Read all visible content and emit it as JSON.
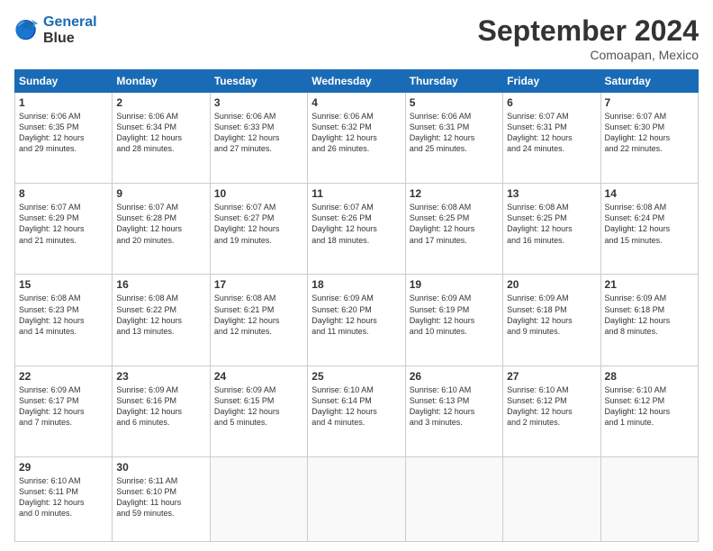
{
  "logo": {
    "line1": "General",
    "line2": "Blue"
  },
  "title": "September 2024",
  "location": "Comoapan, Mexico",
  "weekdays": [
    "Sunday",
    "Monday",
    "Tuesday",
    "Wednesday",
    "Thursday",
    "Friday",
    "Saturday"
  ],
  "weeks": [
    [
      {
        "day": "1",
        "lines": [
          "Sunrise: 6:06 AM",
          "Sunset: 6:35 PM",
          "Daylight: 12 hours",
          "and 29 minutes."
        ]
      },
      {
        "day": "2",
        "lines": [
          "Sunrise: 6:06 AM",
          "Sunset: 6:34 PM",
          "Daylight: 12 hours",
          "and 28 minutes."
        ]
      },
      {
        "day": "3",
        "lines": [
          "Sunrise: 6:06 AM",
          "Sunset: 6:33 PM",
          "Daylight: 12 hours",
          "and 27 minutes."
        ]
      },
      {
        "day": "4",
        "lines": [
          "Sunrise: 6:06 AM",
          "Sunset: 6:32 PM",
          "Daylight: 12 hours",
          "and 26 minutes."
        ]
      },
      {
        "day": "5",
        "lines": [
          "Sunrise: 6:06 AM",
          "Sunset: 6:31 PM",
          "Daylight: 12 hours",
          "and 25 minutes."
        ]
      },
      {
        "day": "6",
        "lines": [
          "Sunrise: 6:07 AM",
          "Sunset: 6:31 PM",
          "Daylight: 12 hours",
          "and 24 minutes."
        ]
      },
      {
        "day": "7",
        "lines": [
          "Sunrise: 6:07 AM",
          "Sunset: 6:30 PM",
          "Daylight: 12 hours",
          "and 22 minutes."
        ]
      }
    ],
    [
      {
        "day": "8",
        "lines": [
          "Sunrise: 6:07 AM",
          "Sunset: 6:29 PM",
          "Daylight: 12 hours",
          "and 21 minutes."
        ]
      },
      {
        "day": "9",
        "lines": [
          "Sunrise: 6:07 AM",
          "Sunset: 6:28 PM",
          "Daylight: 12 hours",
          "and 20 minutes."
        ]
      },
      {
        "day": "10",
        "lines": [
          "Sunrise: 6:07 AM",
          "Sunset: 6:27 PM",
          "Daylight: 12 hours",
          "and 19 minutes."
        ]
      },
      {
        "day": "11",
        "lines": [
          "Sunrise: 6:07 AM",
          "Sunset: 6:26 PM",
          "Daylight: 12 hours",
          "and 18 minutes."
        ]
      },
      {
        "day": "12",
        "lines": [
          "Sunrise: 6:08 AM",
          "Sunset: 6:25 PM",
          "Daylight: 12 hours",
          "and 17 minutes."
        ]
      },
      {
        "day": "13",
        "lines": [
          "Sunrise: 6:08 AM",
          "Sunset: 6:25 PM",
          "Daylight: 12 hours",
          "and 16 minutes."
        ]
      },
      {
        "day": "14",
        "lines": [
          "Sunrise: 6:08 AM",
          "Sunset: 6:24 PM",
          "Daylight: 12 hours",
          "and 15 minutes."
        ]
      }
    ],
    [
      {
        "day": "15",
        "lines": [
          "Sunrise: 6:08 AM",
          "Sunset: 6:23 PM",
          "Daylight: 12 hours",
          "and 14 minutes."
        ]
      },
      {
        "day": "16",
        "lines": [
          "Sunrise: 6:08 AM",
          "Sunset: 6:22 PM",
          "Daylight: 12 hours",
          "and 13 minutes."
        ]
      },
      {
        "day": "17",
        "lines": [
          "Sunrise: 6:08 AM",
          "Sunset: 6:21 PM",
          "Daylight: 12 hours",
          "and 12 minutes."
        ]
      },
      {
        "day": "18",
        "lines": [
          "Sunrise: 6:09 AM",
          "Sunset: 6:20 PM",
          "Daylight: 12 hours",
          "and 11 minutes."
        ]
      },
      {
        "day": "19",
        "lines": [
          "Sunrise: 6:09 AM",
          "Sunset: 6:19 PM",
          "Daylight: 12 hours",
          "and 10 minutes."
        ]
      },
      {
        "day": "20",
        "lines": [
          "Sunrise: 6:09 AM",
          "Sunset: 6:18 PM",
          "Daylight: 12 hours",
          "and 9 minutes."
        ]
      },
      {
        "day": "21",
        "lines": [
          "Sunrise: 6:09 AM",
          "Sunset: 6:18 PM",
          "Daylight: 12 hours",
          "and 8 minutes."
        ]
      }
    ],
    [
      {
        "day": "22",
        "lines": [
          "Sunrise: 6:09 AM",
          "Sunset: 6:17 PM",
          "Daylight: 12 hours",
          "and 7 minutes."
        ]
      },
      {
        "day": "23",
        "lines": [
          "Sunrise: 6:09 AM",
          "Sunset: 6:16 PM",
          "Daylight: 12 hours",
          "and 6 minutes."
        ]
      },
      {
        "day": "24",
        "lines": [
          "Sunrise: 6:09 AM",
          "Sunset: 6:15 PM",
          "Daylight: 12 hours",
          "and 5 minutes."
        ]
      },
      {
        "day": "25",
        "lines": [
          "Sunrise: 6:10 AM",
          "Sunset: 6:14 PM",
          "Daylight: 12 hours",
          "and 4 minutes."
        ]
      },
      {
        "day": "26",
        "lines": [
          "Sunrise: 6:10 AM",
          "Sunset: 6:13 PM",
          "Daylight: 12 hours",
          "and 3 minutes."
        ]
      },
      {
        "day": "27",
        "lines": [
          "Sunrise: 6:10 AM",
          "Sunset: 6:12 PM",
          "Daylight: 12 hours",
          "and 2 minutes."
        ]
      },
      {
        "day": "28",
        "lines": [
          "Sunrise: 6:10 AM",
          "Sunset: 6:12 PM",
          "Daylight: 12 hours",
          "and 1 minute."
        ]
      }
    ],
    [
      {
        "day": "29",
        "lines": [
          "Sunrise: 6:10 AM",
          "Sunset: 6:11 PM",
          "Daylight: 12 hours",
          "and 0 minutes."
        ]
      },
      {
        "day": "30",
        "lines": [
          "Sunrise: 6:11 AM",
          "Sunset: 6:10 PM",
          "Daylight: 11 hours",
          "and 59 minutes."
        ]
      },
      {
        "day": "",
        "lines": []
      },
      {
        "day": "",
        "lines": []
      },
      {
        "day": "",
        "lines": []
      },
      {
        "day": "",
        "lines": []
      },
      {
        "day": "",
        "lines": []
      }
    ]
  ]
}
